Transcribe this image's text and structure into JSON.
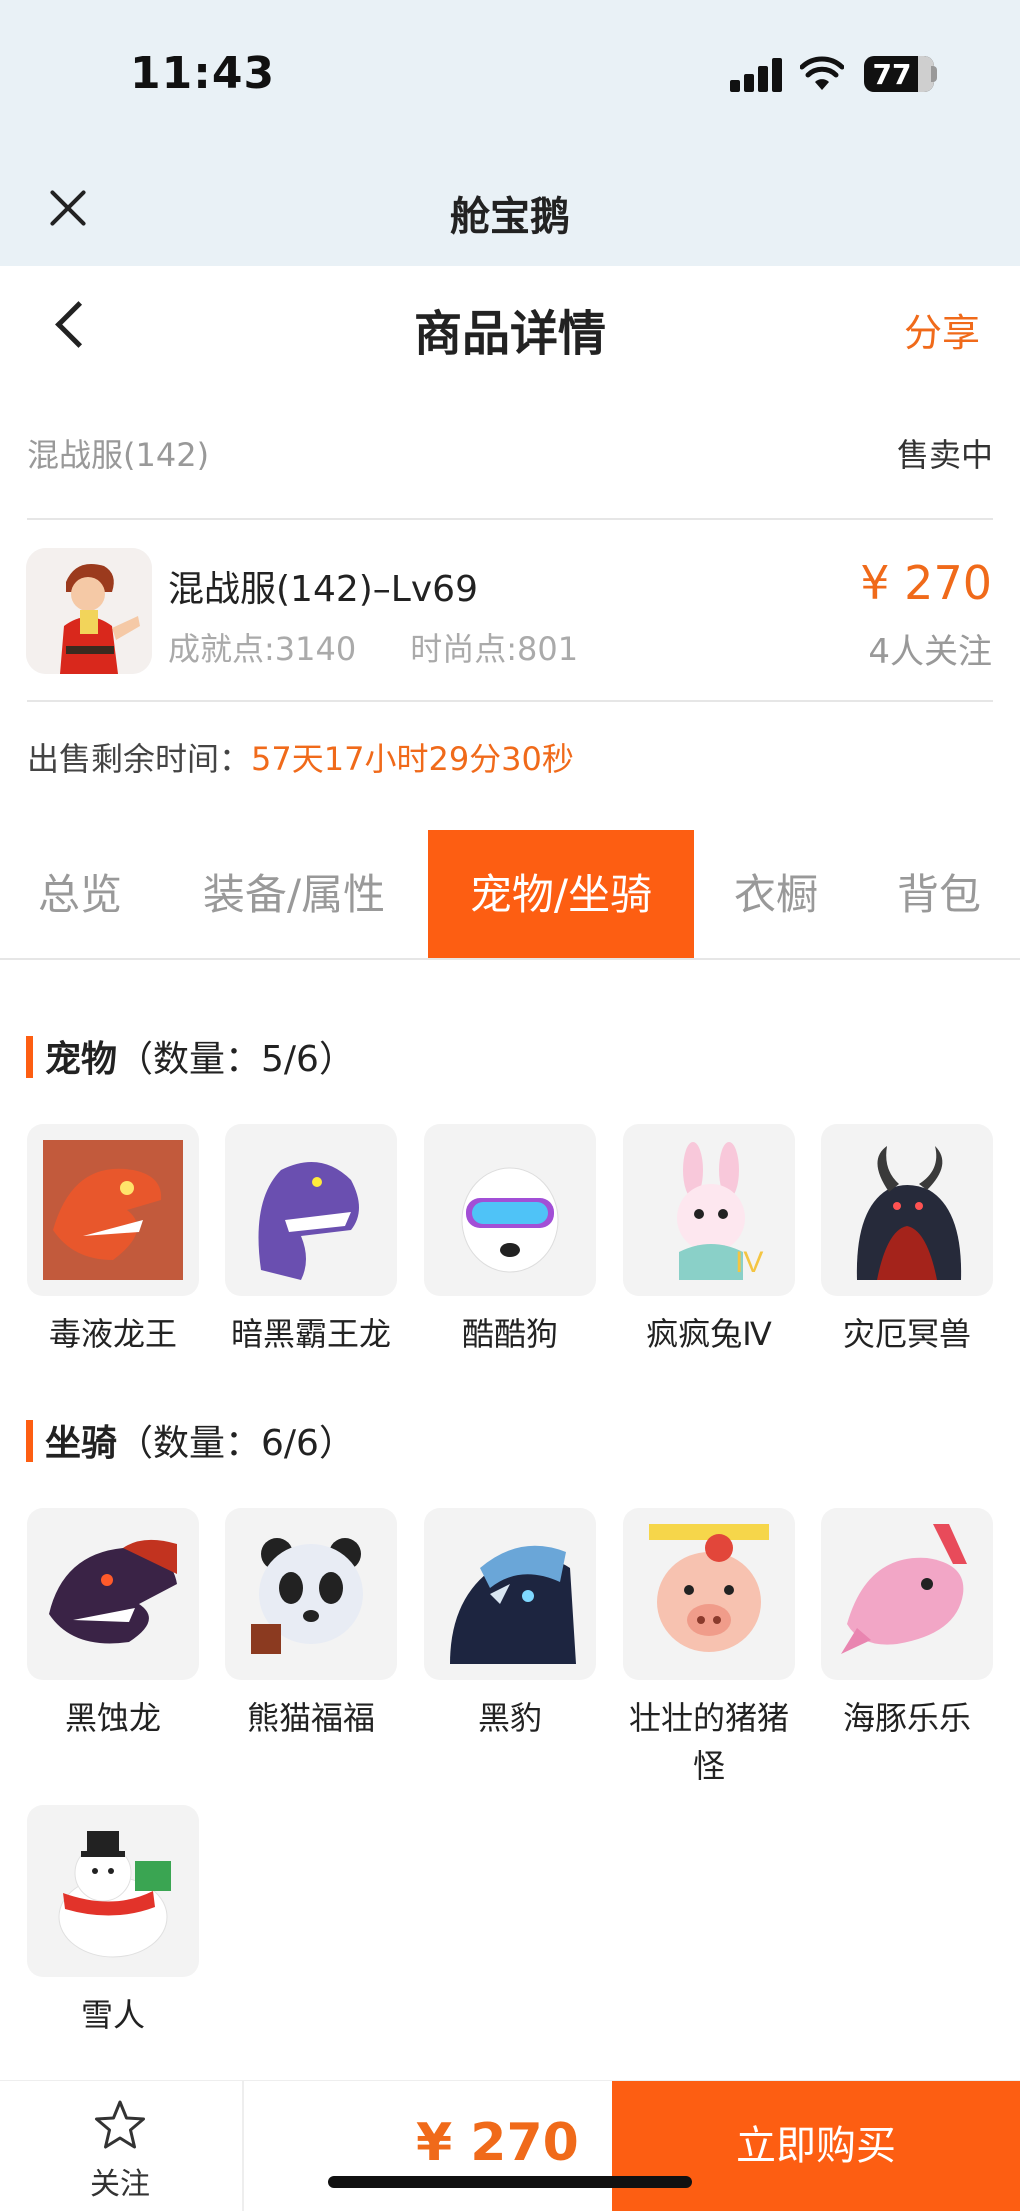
{
  "status_bar": {
    "time": "11:43",
    "battery": "77"
  },
  "app_bar": {
    "title": "舱宝鹅"
  },
  "header": {
    "title": "商品详情",
    "share_label": "分享"
  },
  "server": {
    "name": "混战服(142)",
    "status": "售卖中"
  },
  "character": {
    "name": "混战服(142)–Lv69",
    "achievement": "成就点:3140",
    "fashion": "时尚点:801",
    "price": "¥ 270",
    "followers": "4人关注"
  },
  "remaining": {
    "label": "出售剩余时间：",
    "value": "57天17小时29分30秒"
  },
  "tabs": [
    {
      "label": "总览"
    },
    {
      "label": "装备/属性"
    },
    {
      "label": "宠物/坐骑",
      "active": true
    },
    {
      "label": "衣橱"
    },
    {
      "label": "背包"
    }
  ],
  "pets": {
    "title": "宠物",
    "count": "（数量：5/6）",
    "items": [
      {
        "label": "毒液龙王",
        "icon": "red-dragon-icon"
      },
      {
        "label": "暗黑霸王龙",
        "icon": "purple-trex-icon"
      },
      {
        "label": "酷酷狗",
        "icon": "goggle-dog-icon"
      },
      {
        "label": "疯疯兔Ⅳ",
        "icon": "bunny-icon"
      },
      {
        "label": "灾厄冥兽",
        "icon": "horned-beast-icon"
      }
    ]
  },
  "mounts": {
    "title": "坐骑",
    "count": "（数量：6/6）",
    "items": [
      {
        "label": "黑蚀龙",
        "icon": "black-dragon-icon"
      },
      {
        "label": "熊猫福福",
        "icon": "panda-icon"
      },
      {
        "label": "黑豹",
        "icon": "black-panther-icon"
      },
      {
        "label": "壮壮的猪猪怪",
        "icon": "pig-icon"
      },
      {
        "label": "海豚乐乐",
        "icon": "dolphin-icon"
      },
      {
        "label": "雪人",
        "icon": "snowman-icon"
      }
    ]
  },
  "bottom": {
    "follow_label": "关注",
    "price": "¥ 270",
    "buy_label": "立即购买"
  },
  "colors": {
    "accent": "#fd5e12",
    "price": "#f06a1a",
    "top_bg": "#e9f1f6"
  }
}
